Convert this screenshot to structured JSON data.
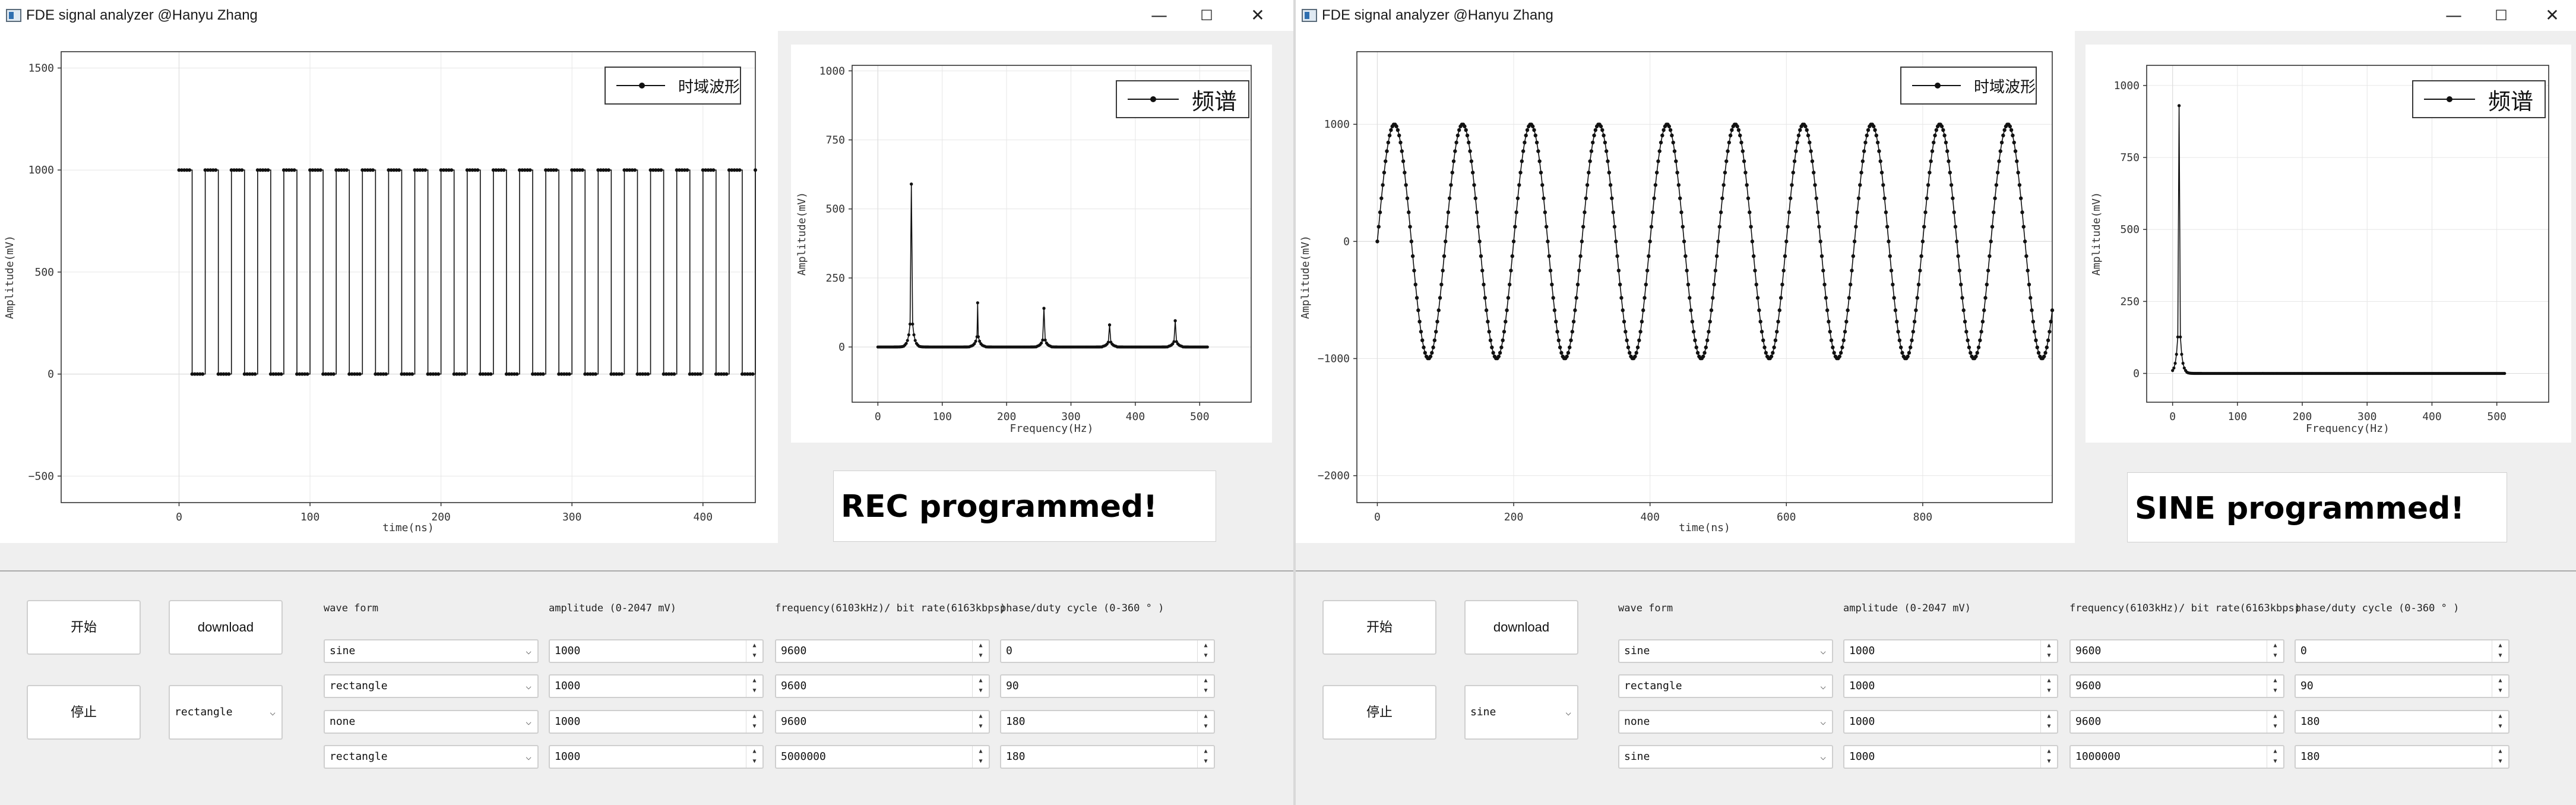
{
  "windows": [
    {
      "id": "win1",
      "title": "FDE signal analyzer @Hanyu Zhang",
      "status": "REC programmed!",
      "time_chart": {
        "legend": "时域波形",
        "xlabel": "time(ns)",
        "ylabel": "Amplitude(mV)",
        "xticks": [
          "0",
          "100",
          "200",
          "300",
          "400"
        ],
        "yticks": [
          "1500",
          "1000",
          "500",
          "0",
          "−500"
        ]
      },
      "freq_chart": {
        "legend": "频谱",
        "xlabel": "Frequency(Hz)",
        "ylabel": "Amplitude(mV)",
        "xticks": [
          "0",
          "100",
          "200",
          "300",
          "400",
          "500"
        ],
        "yticks": [
          "1000",
          "750",
          "500",
          "250",
          "0"
        ]
      },
      "controls": {
        "start_label": "开始",
        "stop_label": "停止",
        "download_label": "download",
        "mode_value": "rectangle",
        "headers": {
          "waveform": "wave form",
          "amplitude": "amplitude (0-2047 mV)",
          "frequency": "frequency(6103kHz)/ bit rate(6163kbps)",
          "phase": "phase/duty cycle (0-360 ° )"
        },
        "rows": [
          {
            "waveform": "sine",
            "amplitude": "1000",
            "frequency": "9600",
            "phase": "0"
          },
          {
            "waveform": "rectangle",
            "amplitude": "1000",
            "frequency": "9600",
            "phase": "90"
          },
          {
            "waveform": "none",
            "amplitude": "1000",
            "frequency": "9600",
            "phase": "180"
          },
          {
            "waveform": "rectangle",
            "amplitude": "1000",
            "frequency": "5000000",
            "phase": "180"
          }
        ]
      }
    },
    {
      "id": "win2",
      "title": "FDE signal analyzer @Hanyu Zhang",
      "status": "SINE programmed!",
      "time_chart": {
        "legend": "时域波形",
        "xlabel": "time(ns)",
        "ylabel": "Amplitude(mV)",
        "xticks": [
          "0",
          "200",
          "400",
          "600",
          "800"
        ],
        "yticks": [
          "1000",
          "0",
          "−1000",
          "−2000"
        ]
      },
      "freq_chart": {
        "legend": "频谱",
        "xlabel": "Frequency(Hz)",
        "ylabel": "Amplitude(mV)",
        "xticks": [
          "0",
          "100",
          "200",
          "300",
          "400",
          "500"
        ],
        "yticks": [
          "1000",
          "750",
          "500",
          "250",
          "0"
        ]
      },
      "controls": {
        "start_label": "开始",
        "stop_label": "停止",
        "download_label": "download",
        "mode_value": "sine",
        "headers": {
          "waveform": "wave form",
          "amplitude": "amplitude (0-2047 mV)",
          "frequency": "frequency(6103kHz)/ bit rate(6163kbps)",
          "phase": "phase/duty cycle (0-360 ° )"
        },
        "rows": [
          {
            "waveform": "sine",
            "amplitude": "1000",
            "frequency": "9600",
            "phase": "0"
          },
          {
            "waveform": "rectangle",
            "amplitude": "1000",
            "frequency": "9600",
            "phase": "90"
          },
          {
            "waveform": "none",
            "amplitude": "1000",
            "frequency": "9600",
            "phase": "180"
          },
          {
            "waveform": "sine",
            "amplitude": "1000",
            "frequency": "1000000",
            "phase": "180"
          }
        ]
      }
    }
  ],
  "window_buttons": {
    "minimize": "—",
    "maximize": "☐",
    "close": "✕"
  },
  "chart_data": [
    {
      "type": "line",
      "name": "win1-time",
      "title": "",
      "xlabel": "time(ns)",
      "ylabel": "Amplitude(mV)",
      "legend": "时域波形",
      "xlim": [
        -90,
        440
      ],
      "ylim": [
        -630,
        1580
      ],
      "signal": {
        "kind": "square",
        "amplitude": 1000,
        "low": 0,
        "start": 0,
        "period": 20,
        "duty": 0.5,
        "end": 440,
        "t0_value": 0
      }
    },
    {
      "type": "line",
      "name": "win1-freq",
      "title": "",
      "xlabel": "Frequency(Hz)",
      "ylabel": "Amplitude(mV)",
      "legend": "频谱",
      "xlim": [
        -40,
        580
      ],
      "ylim": [
        -200,
        1020
      ],
      "peaks": [
        {
          "x": 52,
          "y": 590
        },
        {
          "x": 155,
          "y": 160
        },
        {
          "x": 258,
          "y": 140
        },
        {
          "x": 360,
          "y": 80
        },
        {
          "x": 462,
          "y": 95
        }
      ],
      "baseline": 0,
      "xrange": [
        0,
        512
      ]
    },
    {
      "type": "line",
      "name": "win2-time",
      "title": "",
      "xlabel": "time(ns)",
      "ylabel": "Amplitude(mV)",
      "legend": "时域波形",
      "xlim": [
        -30,
        990
      ],
      "ylim": [
        -2230,
        1620
      ],
      "signal": {
        "kind": "sine",
        "amplitude": 1000,
        "period": 100,
        "start": 0,
        "end": 990
      }
    },
    {
      "type": "line",
      "name": "win2-freq",
      "title": "",
      "xlabel": "Frequency(Hz)",
      "ylabel": "Amplitude(mV)",
      "legend": "频谱",
      "xlim": [
        -40,
        580
      ],
      "ylim": [
        -100,
        1070
      ],
      "peaks": [
        {
          "x": 10,
          "y": 930
        }
      ],
      "baseline": 0,
      "xrange": [
        0,
        512
      ]
    }
  ]
}
